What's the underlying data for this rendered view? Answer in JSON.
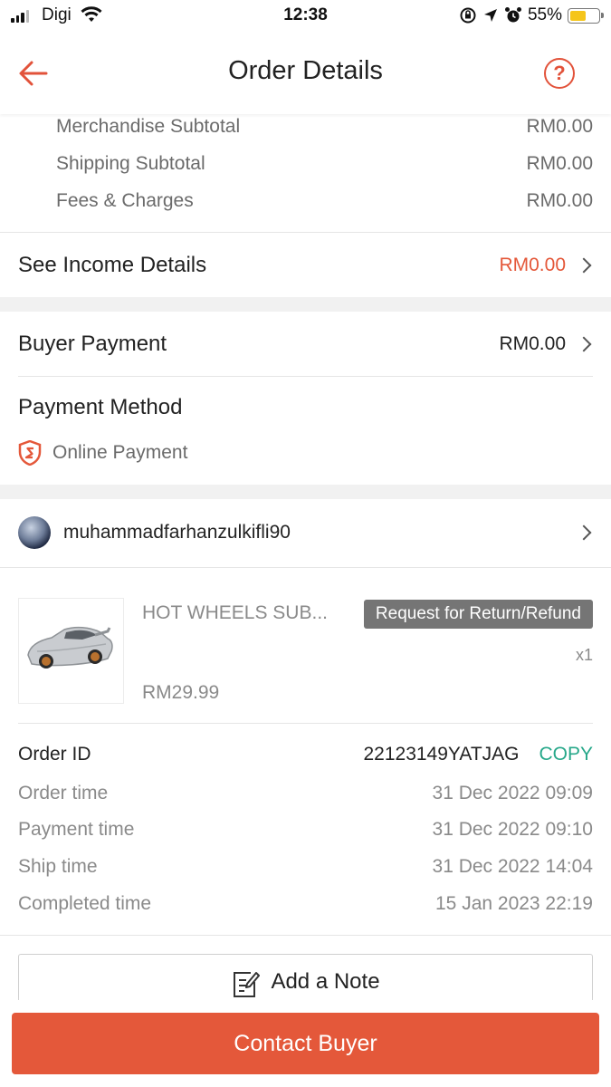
{
  "status_bar": {
    "carrier": "Digi",
    "time": "12:38",
    "battery": "55%",
    "battery_level": 0.55
  },
  "header": {
    "title": "Order Details",
    "help_symbol": "?"
  },
  "income_breakdown": [
    {
      "label": "Merchandise Subtotal",
      "value": "RM0.00"
    },
    {
      "label": "Shipping Subtotal",
      "value": "RM0.00"
    },
    {
      "label": "Fees & Charges",
      "value": "RM0.00"
    }
  ],
  "income_details": {
    "label": "See Income Details",
    "value": "RM0.00"
  },
  "buyer_payment": {
    "label": "Buyer Payment",
    "value": "RM0.00"
  },
  "payment_method": {
    "label": "Payment Method",
    "value": "Online Payment"
  },
  "buyer": {
    "username": "muhammadfarhanzulkifli90"
  },
  "product": {
    "name": "HOT WHEELS SUB...",
    "badge": "Request for Return/Refund",
    "quantity": "x1",
    "price": "RM29.99"
  },
  "order_info": {
    "order_id_label": "Order ID",
    "order_id": "22123149YATJAG",
    "copy_label": "COPY",
    "rows": [
      {
        "label": "Order time",
        "value": "31 Dec 2022 09:09"
      },
      {
        "label": "Payment time",
        "value": "31 Dec 2022 09:10"
      },
      {
        "label": "Ship time",
        "value": "31 Dec 2022 14:04"
      },
      {
        "label": "Completed time",
        "value": "15 Jan 2023 22:19"
      }
    ]
  },
  "actions": {
    "add_note": "Add a Note",
    "contact_buyer": "Contact Buyer"
  },
  "colors": {
    "accent": "#e4583a",
    "copy": "#27a88a",
    "badge": "#757575"
  },
  "icons": [
    "signal-icon",
    "wifi-icon",
    "lock-rotation-icon",
    "location-arrow-icon",
    "alarm-icon",
    "battery-icon",
    "back-arrow-icon",
    "help-icon",
    "chevron-right-icon",
    "shield-s-icon",
    "note-edit-icon"
  ]
}
